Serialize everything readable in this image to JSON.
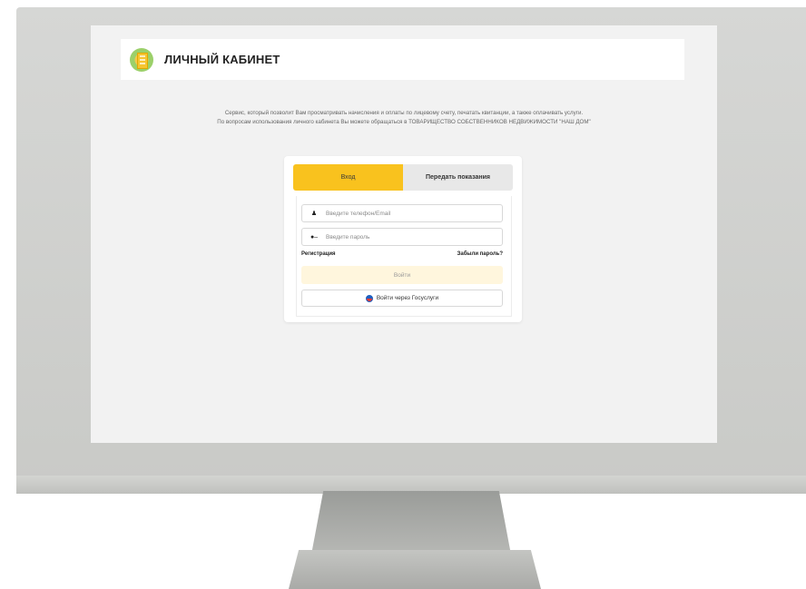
{
  "header": {
    "title": "ЛИЧНЫЙ КАБИНЕТ"
  },
  "description": {
    "line1": "Сервис, который позволит Вам просматривать начисления и оплаты по лицевому счету, печатать квитанции, а также оплачивать услуги.",
    "line2": "По вопросам использования личного кабинета Вы можете обращаться в ТОВАРИЩЕСТВО СОБСТВЕННИКОВ НЕДВИЖИМОСТИ \"НАШ ДОМ\""
  },
  "tabs": [
    {
      "label": "Вход",
      "active": true
    },
    {
      "label": "Передать показания",
      "active": false
    }
  ],
  "form": {
    "phone_placeholder": "Введите телефон/Email",
    "password_placeholder": "Введите пароль",
    "register_link": "Регистрация",
    "forgot_link": "Забыли пароль?",
    "login_button": "Войти",
    "gosuslugi_button": "Войти через Госуслуги"
  },
  "icons": {
    "user": "user-icon",
    "key": "key-icon",
    "gosuslugi": "gosuslugi-icon",
    "logo": "building-logo-icon"
  },
  "colors": {
    "accent": "#f9c21e",
    "login_button_bg": "#fff6dd",
    "inactive_tab": "#e8e8e8"
  }
}
